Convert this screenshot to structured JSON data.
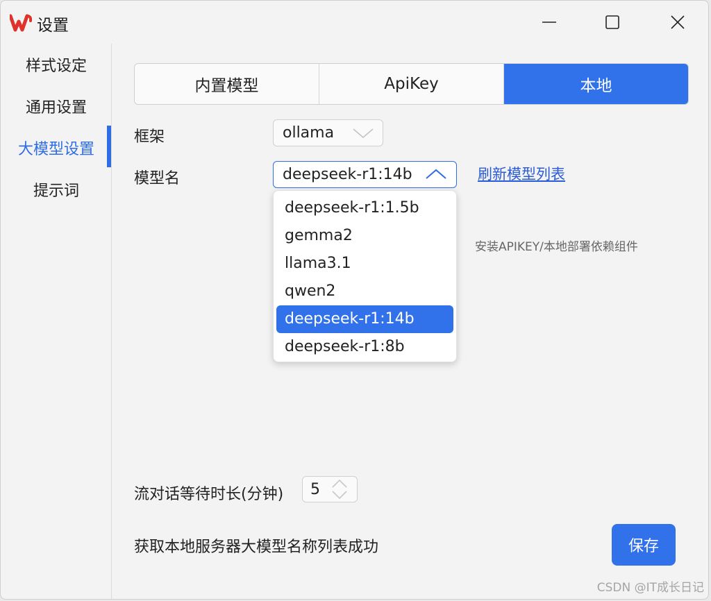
{
  "window": {
    "title": "设置",
    "controls": {
      "minimize": "minimize-icon",
      "maximize": "maximize-icon",
      "close": "close-icon"
    }
  },
  "sidebar": {
    "items": [
      {
        "label": "样式设定",
        "active": false
      },
      {
        "label": "通用设置",
        "active": false
      },
      {
        "label": "大模型设置",
        "active": true
      },
      {
        "label": "提示词",
        "active": false
      }
    ]
  },
  "tabs": [
    {
      "label": "内置模型",
      "active": false
    },
    {
      "label": "ApiKey",
      "active": false
    },
    {
      "label": "本地",
      "active": true
    }
  ],
  "framework": {
    "label": "框架",
    "value": "ollama"
  },
  "model": {
    "label": "模型名",
    "value": "deepseek-r1:14b",
    "options": [
      "deepseek-r1:1.5b",
      "gemma2",
      "llama3.1",
      "qwen2",
      "deepseek-r1:14b",
      "deepseek-r1:8b"
    ],
    "selected_option": "deepseek-r1:14b"
  },
  "refresh_link": "刷新模型列表",
  "hint": "安装APIKEY/本地部署依赖组件",
  "wait": {
    "label": "流对话等待时长(分钟)",
    "value": "5"
  },
  "status": "获取本地服务器大模型名称列表成功",
  "save_label": "保存",
  "watermark": "CSDN @IT成长日记",
  "colors": {
    "accent": "#3171ea",
    "link": "#2a5bd7",
    "logo": "#e0322c"
  }
}
